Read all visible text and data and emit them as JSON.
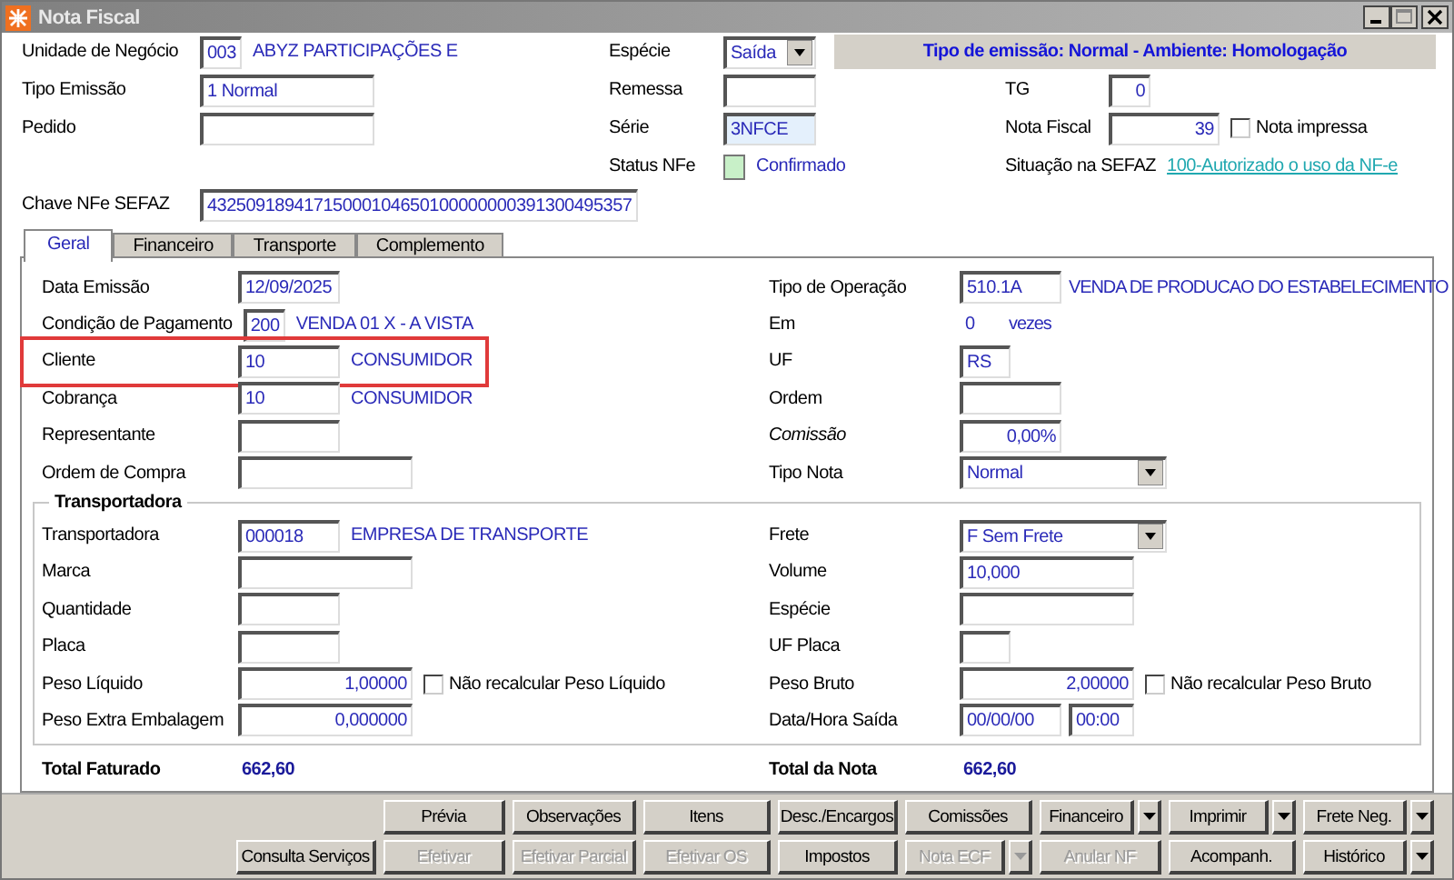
{
  "window": {
    "title": "Nota Fiscal"
  },
  "header": {
    "unidade": {
      "label": "Unidade de Negócio",
      "value": "003",
      "description": "ABYZ PARTICIPAÇÕES E"
    },
    "tipo_emissao": {
      "label": "Tipo Emissão",
      "value": "1 Normal"
    },
    "pedido": {
      "label": "Pedido"
    },
    "chave": {
      "label": "Chave NFe SEFAZ",
      "value": "43250918941715000104650100000000391300495357"
    },
    "especie": {
      "label": "Espécie",
      "value": "Saída"
    },
    "remessa": {
      "label": "Remessa"
    },
    "serie": {
      "label": "Série",
      "value": "3NFCE"
    },
    "status": {
      "label": "Status NFe",
      "value": "Confirmado"
    },
    "banner": "Tipo de emissão: Normal - Ambiente: Homologação",
    "tg": {
      "label": "TG",
      "value": "0"
    },
    "nota_fiscal": {
      "label": "Nota Fiscal",
      "value": "39"
    },
    "nota_impressa": {
      "label": "Nota impressa",
      "checked": false
    },
    "situacao": {
      "label": "Situação na SEFAZ",
      "link": "100-Autorizado o uso da NF-e"
    }
  },
  "tabs": [
    {
      "label": "Geral",
      "selected": true
    },
    {
      "label": "Financeiro",
      "selected": false
    },
    {
      "label": "Transporte",
      "selected": false
    },
    {
      "label": "Complemento",
      "selected": false
    }
  ],
  "geral": {
    "left": [
      {
        "kind": "field",
        "label": "Data Emissão",
        "value": "12/09/2025",
        "highlighted": false
      },
      {
        "kind": "field",
        "label": "Condição de Pagamento",
        "value": "200",
        "description": "VENDA 01 X - A VISTA",
        "highlighted": false
      },
      {
        "kind": "field",
        "label": "Cliente",
        "value": "10",
        "description": "CONSUMIDOR",
        "highlighted": true
      },
      {
        "kind": "field",
        "label": "Cobrança",
        "value": "10",
        "description": "CONSUMIDOR",
        "highlighted": false
      },
      {
        "kind": "field",
        "label": "Representante",
        "highlighted": false
      },
      {
        "kind": "field",
        "label": "Ordem de Compra",
        "highlighted": false
      }
    ],
    "right": [
      {
        "kind": "field",
        "label": "Tipo de Operação",
        "value": "510.1A",
        "description": "VENDA DE PRODUCAO DO ESTABELECIMENTO",
        "italic": false
      },
      {
        "kind": "plain",
        "label": "Em",
        "value": "0",
        "unit": "vezes",
        "italic": false
      },
      {
        "kind": "field",
        "label": "UF",
        "value": "RS",
        "italic": false
      },
      {
        "kind": "field",
        "label": "Ordem",
        "italic": false
      },
      {
        "kind": "number",
        "label": "Comissão",
        "value": "0,00%",
        "italic": true
      },
      {
        "kind": "select",
        "label": "Tipo Nota",
        "value": "Normal",
        "italic": false
      }
    ]
  },
  "transportadora": {
    "title": "Transportadora",
    "left": [
      {
        "kind": "field",
        "label": "Transportadora",
        "value": "000018",
        "description": "EMPRESA DE TRANSPORTE"
      },
      {
        "kind": "field",
        "label": "Marca"
      },
      {
        "kind": "field",
        "label": "Quantidade"
      },
      {
        "kind": "field",
        "label": "Placa"
      },
      {
        "kind": "number",
        "label": "Peso Líquido",
        "value": "1,00000",
        "checkbox": {
          "label": "Não recalcular Peso Líquido",
          "checked": false
        }
      },
      {
        "kind": "number",
        "label": "Peso Extra Embalagem",
        "value": "0,000000"
      }
    ],
    "right": [
      {
        "kind": "select",
        "label": "Frete",
        "value": "F Sem Frete"
      },
      {
        "kind": "field",
        "label": "Volume",
        "value": "10,000"
      },
      {
        "kind": "field",
        "label": "Espécie"
      },
      {
        "kind": "field",
        "label": "UF Placa"
      },
      {
        "kind": "number",
        "label": "Peso Bruto",
        "value": "2,00000",
        "checkbox": {
          "label": "Não recalcular Peso Bruto",
          "checked": false
        }
      },
      {
        "kind": "pair",
        "label": "Data/Hora Saída",
        "values": [
          "00/00/00",
          "00:00"
        ]
      }
    ]
  },
  "totals": [
    {
      "label": "Total Faturado",
      "value": "662,60"
    },
    {
      "label": "Total da Nota",
      "value": "662,60"
    }
  ],
  "buttons": [
    [
      {
        "label": "Prévia",
        "disabled": false,
        "dropdown": false
      },
      {
        "label": "Observações",
        "disabled": false,
        "dropdown": false
      },
      {
        "label": "Itens",
        "disabled": false,
        "dropdown": false
      },
      {
        "label": "Desc./Encargos",
        "disabled": false,
        "dropdown": false
      },
      {
        "label": "Comissões",
        "disabled": false,
        "dropdown": false
      },
      {
        "label": "Financeiro",
        "disabled": false,
        "dropdown": true
      },
      {
        "label": "Imprimir",
        "disabled": false,
        "dropdown": true
      },
      {
        "label": "Frete Neg.",
        "disabled": false,
        "dropdown": true
      }
    ],
    [
      {
        "label": "Consulta Serviços",
        "disabled": false,
        "dropdown": false
      },
      {
        "label": "Efetivar",
        "disabled": true,
        "dropdown": false
      },
      {
        "label": "Efetivar Parcial",
        "disabled": true,
        "dropdown": false
      },
      {
        "label": "Efetivar OS",
        "disabled": true,
        "dropdown": false
      },
      {
        "label": "Impostos",
        "disabled": false,
        "dropdown": false
      },
      {
        "label": "Nota ECF",
        "disabled": true,
        "dropdown": true
      },
      {
        "label": "Anular NF",
        "disabled": true,
        "dropdown": false
      },
      {
        "label": "Acompanh.",
        "disabled": false,
        "dropdown": false
      },
      {
        "label": "Histórico",
        "disabled": false,
        "dropdown": true
      }
    ]
  ]
}
